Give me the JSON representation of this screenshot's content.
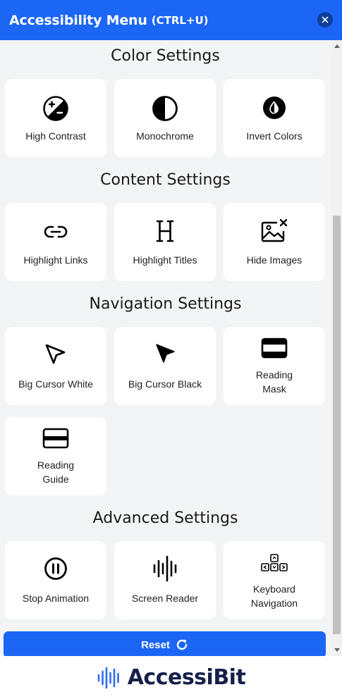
{
  "header": {
    "title": "Accessibility Menu",
    "shortcut": "(CTRL+U)",
    "close_icon": "close-icon"
  },
  "sections": {
    "color": {
      "title": "Color Settings",
      "items": [
        {
          "label": "High Contrast",
          "icon": "contrast-plus-minus-icon"
        },
        {
          "label": "Monochrome",
          "icon": "half-circle-icon"
        },
        {
          "label": "Invert Colors",
          "icon": "invert-colors-icon"
        }
      ]
    },
    "content": {
      "title": "Content Settings",
      "items": [
        {
          "label": "Highlight Links",
          "icon": "link-icon"
        },
        {
          "label": "Highlight Titles",
          "icon": "heading-icon"
        },
        {
          "label": "Hide Images",
          "icon": "image-off-icon"
        }
      ]
    },
    "navigation": {
      "title": "Navigation Settings",
      "items": [
        {
          "label": "Big Cursor White",
          "icon": "cursor-white-icon"
        },
        {
          "label": "Big Cursor Black",
          "icon": "cursor-black-icon"
        },
        {
          "label_line1": "Reading",
          "label_line2": "Mask",
          "icon": "reading-mask-icon"
        },
        {
          "label_line1": "Reading",
          "label_line2": "Guide",
          "icon": "reading-guide-icon"
        }
      ]
    },
    "advanced": {
      "title": "Advanced Settings",
      "items": [
        {
          "label": "Stop Animation",
          "icon": "pause-icon"
        },
        {
          "label": "Screen Reader",
          "icon": "sound-wave-icon"
        },
        {
          "label_line1": "Keyboard",
          "label_line2": "Navigation",
          "icon": "keyboard-icon"
        }
      ]
    }
  },
  "reset": {
    "label": "Reset",
    "icon": "refresh-icon"
  },
  "footer": {
    "brand": "AccessiBit",
    "logo_icon": "sound-wave-logo-icon"
  },
  "colors": {
    "primary": "#1b66f5",
    "close_bg": "#0e3f9c",
    "panel_bg": "#f3f4f6",
    "brand_text": "#16204a",
    "logo_blue": "#2f6bf0"
  }
}
